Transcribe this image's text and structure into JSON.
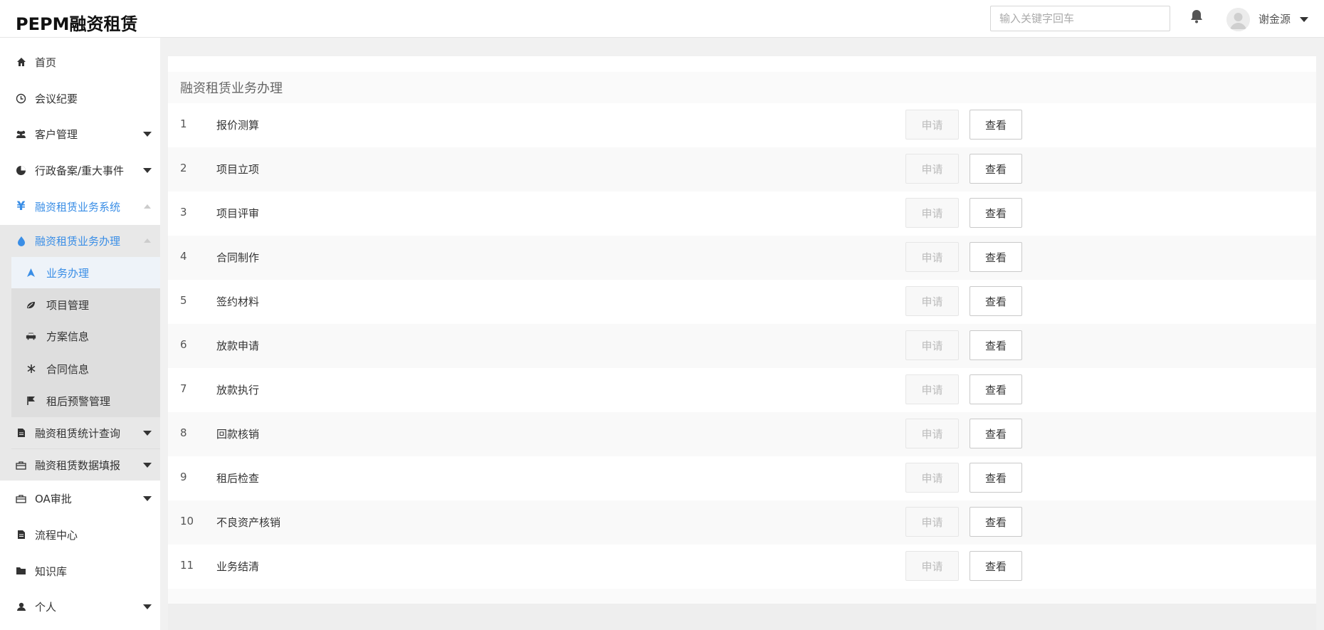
{
  "app": {
    "title": "PEPM融资租赁"
  },
  "header": {
    "search_placeholder": "输入关键字回车",
    "user_name": "谢金源"
  },
  "sidebar": {
    "items": [
      {
        "label": "首页",
        "icon": "home-icon"
      },
      {
        "label": "会议纪要",
        "icon": "clock-icon"
      },
      {
        "label": "客户管理",
        "icon": "users-icon",
        "expandable": true
      },
      {
        "label": "行政备案/重大事件",
        "icon": "pie-chart-icon",
        "expandable": true
      },
      {
        "label": "融资租赁业务系统",
        "icon": "yen-icon",
        "expanded": true
      },
      {
        "label": "融资租赁业务办理",
        "icon": "drop-icon",
        "expanded": true
      },
      {
        "label": "融资租赁统计查询",
        "icon": "document-icon",
        "expandable": true
      },
      {
        "label": "融资租赁数据填报",
        "icon": "briefcase-icon",
        "expandable": true
      },
      {
        "label": "OA审批",
        "icon": "briefcase-icon",
        "expandable": true
      },
      {
        "label": "流程中心",
        "icon": "document-icon"
      },
      {
        "label": "知识库",
        "icon": "folder-icon"
      },
      {
        "label": "个人",
        "icon": "user-icon",
        "expandable": true
      }
    ],
    "sub_items": [
      {
        "label": "业务办理",
        "icon": "navigation-arrow-icon",
        "selected": true
      },
      {
        "label": "项目管理",
        "icon": "leaf-icon"
      },
      {
        "label": "方案信息",
        "icon": "car-icon"
      },
      {
        "label": "合同信息",
        "icon": "asterisk-icon"
      },
      {
        "label": "租后预警管理",
        "icon": "flag-icon"
      }
    ]
  },
  "main": {
    "title": "融资租赁业务办理",
    "apply_label": "申请",
    "view_label": "查看",
    "rows": [
      {
        "num": "1",
        "name": "报价测算"
      },
      {
        "num": "2",
        "name": "项目立项"
      },
      {
        "num": "3",
        "name": "项目评审"
      },
      {
        "num": "4",
        "name": "合同制作"
      },
      {
        "num": "5",
        "name": "签约材料"
      },
      {
        "num": "6",
        "name": "放款申请"
      },
      {
        "num": "7",
        "name": "放款执行"
      },
      {
        "num": "8",
        "name": "回款核销"
      },
      {
        "num": "9",
        "name": "租后检查"
      },
      {
        "num": "10",
        "name": "不良资产核销"
      },
      {
        "num": "11",
        "name": "业务结清"
      }
    ]
  },
  "colors": {
    "accent": "#3a8ee6",
    "sidebar_sub_bg": "#dedede"
  }
}
